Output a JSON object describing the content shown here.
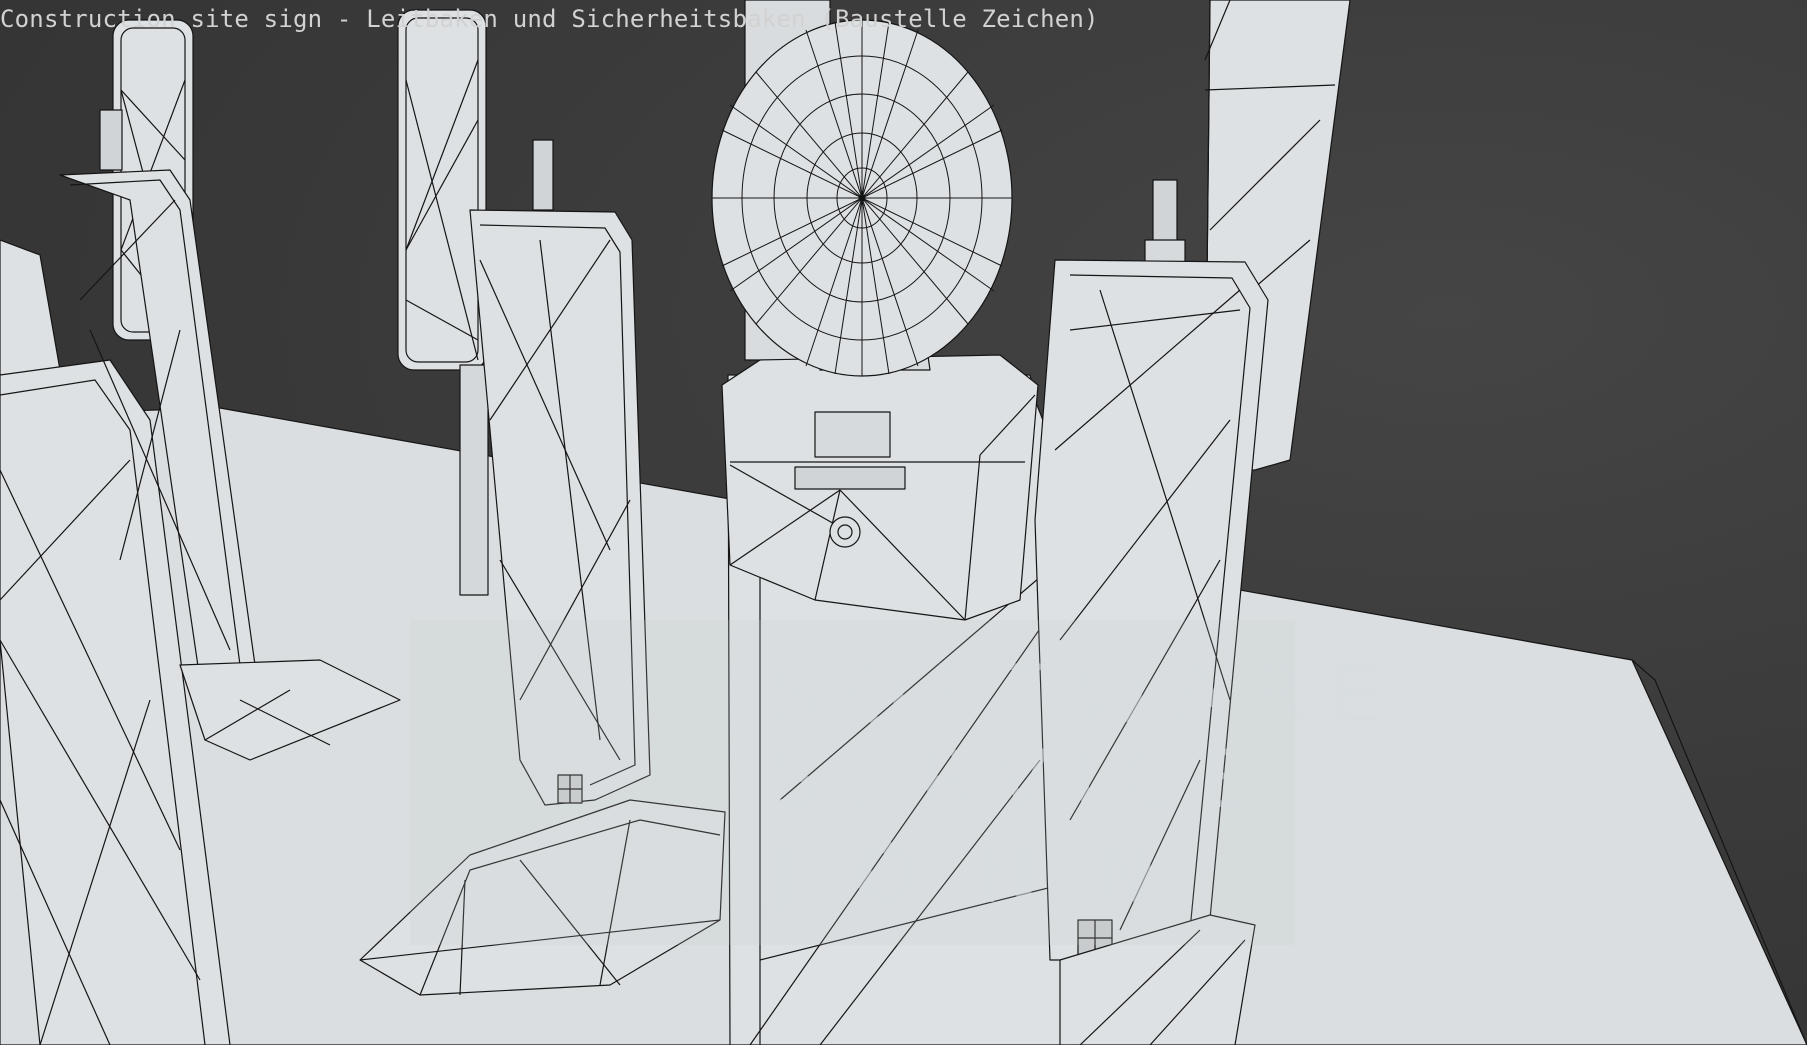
{
  "viewport": {
    "caption": "Construction site sign - Leitbaken und Sicherheitsbaken (Baustelle Zeichen)"
  },
  "watermark": {
    "line1": "SOFTWARE",
    "line2": "SERVICE",
    "line3": "JOHN"
  },
  "colors": {
    "background": "#3a3a3a",
    "surface": "#dde1e3",
    "wireframe": "#111111",
    "caption_text": "#d2d2d2"
  }
}
